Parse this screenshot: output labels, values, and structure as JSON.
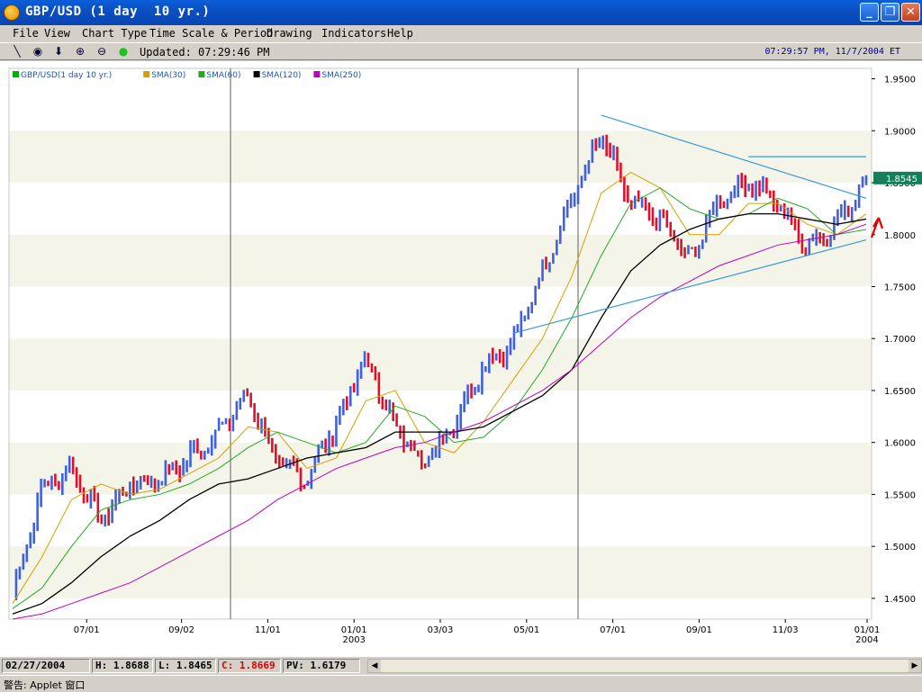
{
  "window": {
    "title": "GBP/USD (1 day  10 yr.)",
    "minimize_glyph": "_",
    "maximize_glyph": "❐",
    "close_glyph": "✕"
  },
  "menu": [
    "File",
    "View",
    "Chart Type",
    "Time Scale & Period",
    "Drawing",
    "Indicators",
    "Help"
  ],
  "toolbar": {
    "tools": [
      {
        "name": "draw-line-icon",
        "glyph": "╲"
      },
      {
        "name": "crosshair-icon",
        "glyph": "◉"
      },
      {
        "name": "download-arrow-icon",
        "glyph": "⬇"
      },
      {
        "name": "zoom-in-icon",
        "glyph": "⊕"
      },
      {
        "name": "zoom-out-icon",
        "glyph": "⊖"
      },
      {
        "name": "status-light-icon",
        "glyph": "●"
      }
    ],
    "updated": "Updated: 07:29:46 PM",
    "clock": "07:29:57 PM, 11/7/2004 ET"
  },
  "legend": [
    {
      "label": "GBP/USD(1 day  10 yr.)",
      "color": "#00b000"
    },
    {
      "label": "SMA(30)",
      "color": "#d4a000"
    },
    {
      "label": "SMA(60)",
      "color": "#22aa22"
    },
    {
      "label": "SMA(120)",
      "color": "#000000"
    },
    {
      "label": "SMA(250)",
      "color": "#c000c0"
    }
  ],
  "status": {
    "date": "02/27/2004",
    "high": "H: 1.8688",
    "low": "L: 1.8465",
    "close": "C: 1.8669",
    "pv": "PV: 1.6179",
    "applet": "警告: Applet 窗口"
  },
  "colors": {
    "up_bar": "#4060e0",
    "down_bar": "#e0102a",
    "band": "#f4f5e8",
    "trendline": "#3a9ad9",
    "price_tag": "#14805a"
  },
  "chart_data": {
    "type": "line",
    "ylim": [
      1.43,
      1.96
    ],
    "y_ticks": [
      "1.4500",
      "1.5000",
      "1.5500",
      "1.6000",
      "1.6500",
      "1.7000",
      "1.7500",
      "1.8000",
      "1.8500",
      "1.9000",
      "1.9500"
    ],
    "x_ticks": [
      {
        "label": "07/01",
        "t": 0.09
      },
      {
        "label": "09/02",
        "t": 0.2
      },
      {
        "label": "11/01",
        "t": 0.3
      },
      {
        "label": "01/01",
        "sub": "2003",
        "t": 0.4
      },
      {
        "label": "03/03",
        "t": 0.5
      },
      {
        "label": "05/01",
        "t": 0.6
      },
      {
        "label": "07/01",
        "t": 0.7
      },
      {
        "label": "09/01",
        "t": 0.8
      },
      {
        "label": "11/03",
        "t": 0.9
      },
      {
        "label": "01/01",
        "sub": "2004",
        "t": 1.0
      }
    ],
    "last_price": "1.8545",
    "price_series": [
      {
        "x": "2002-06",
        "y": 1.455
      },
      {
        "x": "2002-07",
        "y": 1.555
      },
      {
        "x": "2002-08",
        "y": 1.575
      },
      {
        "x": "2002-09",
        "y": 1.525
      },
      {
        "x": "2002-10",
        "y": 1.56
      },
      {
        "x": "2002-11",
        "y": 1.565
      },
      {
        "x": "2002-12",
        "y": 1.585
      },
      {
        "x": "2003-01",
        "y": 1.61
      },
      {
        "x": "2003-02",
        "y": 1.645
      },
      {
        "x": "2003-03",
        "y": 1.58
      },
      {
        "x": "2003-04",
        "y": 1.565
      },
      {
        "x": "2003-05",
        "y": 1.62
      },
      {
        "x": "2003-06",
        "y": 1.68
      },
      {
        "x": "2003-07",
        "y": 1.615
      },
      {
        "x": "2003-08",
        "y": 1.58
      },
      {
        "x": "2003-09",
        "y": 1.62
      },
      {
        "x": "2003-10",
        "y": 1.675
      },
      {
        "x": "2003-11",
        "y": 1.695
      },
      {
        "x": "2003-12",
        "y": 1.765
      },
      {
        "x": "2004-01",
        "y": 1.835
      },
      {
        "x": "2004-02",
        "y": 1.895
      },
      {
        "x": "2004-03",
        "y": 1.83
      },
      {
        "x": "2004-04",
        "y": 1.815
      },
      {
        "x": "2004-05",
        "y": 1.775
      },
      {
        "x": "2004-06",
        "y": 1.835
      },
      {
        "x": "2004-07",
        "y": 1.85
      },
      {
        "x": "2004-08",
        "y": 1.83
      },
      {
        "x": "2004-09",
        "y": 1.79
      },
      {
        "x": "2004-10",
        "y": 1.81
      },
      {
        "x": "2004-11",
        "y": 1.855
      }
    ],
    "series": [
      {
        "name": "SMA(30)",
        "values": [
          1.445,
          1.49,
          1.545,
          1.56,
          1.55,
          1.555,
          1.57,
          1.585,
          1.615,
          1.61,
          1.575,
          1.585,
          1.64,
          1.65,
          1.6,
          1.59,
          1.62,
          1.66,
          1.7,
          1.76,
          1.84,
          1.86,
          1.845,
          1.8,
          1.8,
          1.83,
          1.83,
          1.81,
          1.8,
          1.82
        ]
      },
      {
        "name": "SMA(60)",
        "values": [
          1.44,
          1.46,
          1.5,
          1.535,
          1.545,
          1.55,
          1.56,
          1.575,
          1.595,
          1.61,
          1.6,
          1.59,
          1.6,
          1.635,
          1.625,
          1.6,
          1.605,
          1.63,
          1.67,
          1.72,
          1.78,
          1.83,
          1.845,
          1.825,
          1.815,
          1.82,
          1.835,
          1.825,
          1.8,
          1.805
        ]
      },
      {
        "name": "SMA(120)",
        "values": [
          1.435,
          1.445,
          1.465,
          1.49,
          1.51,
          1.525,
          1.545,
          1.56,
          1.565,
          1.575,
          1.585,
          1.59,
          1.595,
          1.61,
          1.61,
          1.61,
          1.615,
          1.63,
          1.645,
          1.67,
          1.72,
          1.765,
          1.79,
          1.805,
          1.815,
          1.82,
          1.82,
          1.815,
          1.81,
          1.815
        ]
      },
      {
        "name": "SMA(250)",
        "values": [
          1.43,
          1.435,
          1.445,
          1.455,
          1.465,
          1.48,
          1.495,
          1.51,
          1.525,
          1.545,
          1.56,
          1.575,
          1.585,
          1.595,
          1.6,
          1.61,
          1.62,
          1.635,
          1.65,
          1.67,
          1.695,
          1.72,
          1.74,
          1.755,
          1.77,
          1.78,
          1.79,
          1.795,
          1.8,
          1.81
        ]
      }
    ],
    "trendlines": [
      {
        "from": {
          "x": "2003-11",
          "y": 1.705
        },
        "to": {
          "x": "2004-11",
          "y": 1.795
        }
      },
      {
        "from": {
          "x": "2004-02",
          "y": 1.915
        },
        "to": {
          "x": "2004-11",
          "y": 1.835
        }
      },
      {
        "from": {
          "x": "2004-07",
          "y": 1.875
        },
        "to": {
          "x": "2004-11",
          "y": 1.875
        }
      }
    ],
    "grid": true
  }
}
